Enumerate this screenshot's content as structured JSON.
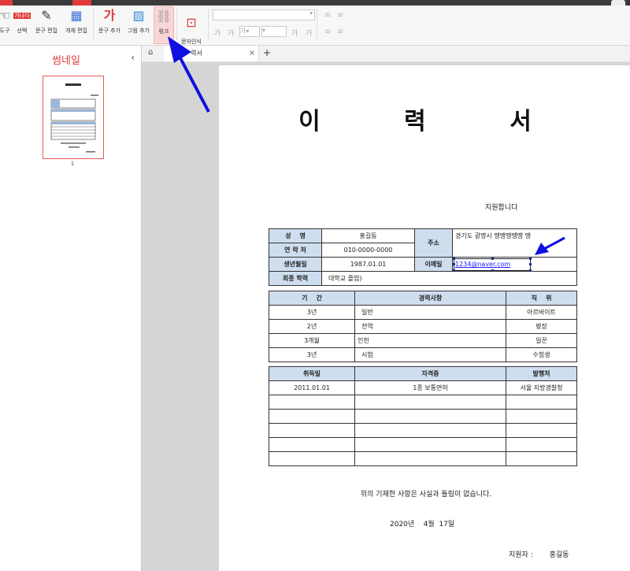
{
  "toolbar": {
    "tools": [
      {
        "name": "hand-tool",
        "label": "도구"
      },
      {
        "name": "select-tool",
        "label": "선택"
      },
      {
        "name": "edit-text-tool",
        "label": "문구 편집"
      },
      {
        "name": "edit-object-tool",
        "label": "개체 편집"
      },
      {
        "name": "add-text-tool",
        "label": "문구 추가"
      },
      {
        "name": "add-image-tool",
        "label": "그림 추가"
      },
      {
        "name": "link-tool",
        "label": "링크"
      },
      {
        "name": "ocr-tool",
        "label": "문자인식\n(OCR)"
      }
    ],
    "select_icon_text": "가나다",
    "add_text_icon": "가",
    "format_buttons": [
      "가",
      "가",
      "가",
      "가",
      "가",
      "가"
    ]
  },
  "thumbnail_panel": {
    "title": "썸네일",
    "page_number": "1"
  },
  "doc_tab": {
    "name": "력서"
  },
  "document": {
    "title": "이 력 서",
    "apply_text": "지원합니다",
    "personal": {
      "name_label": "성    명",
      "name_value": "홍길동",
      "address_label": "주소",
      "address_value": "경기도 광명시 땡땡땡땡땡 땡",
      "phone_label": "연 락 처",
      "phone_value": "010-0000-0000",
      "birth_label": "생년월일",
      "birth_value": "1987.01.01",
      "email_label": "이메일",
      "email_value": "1234@naver.com",
      "edu_label": "최종 학력",
      "edu_value": "대학교 졸업)"
    },
    "career": {
      "headers": [
        "기    간",
        "경력사항",
        "직    위"
      ],
      "rows": [
        [
          "3년",
          "일반",
          "아르바이트"
        ],
        [
          "2년",
          "전역",
          "병장"
        ],
        [
          "3개월",
          "인천",
          "일꾼"
        ],
        [
          "3년",
          "시험",
          "수험생"
        ]
      ]
    },
    "license": {
      "headers": [
        "취득일",
        "자격증",
        "발행처"
      ],
      "rows": [
        [
          "2011.01.01",
          "1종 보통면허",
          "서울 지방경찰청"
        ],
        [
          "",
          "",
          ""
        ],
        [
          "",
          "",
          ""
        ],
        [
          "",
          "",
          ""
        ],
        [
          "",
          "",
          ""
        ],
        [
          "",
          "",
          ""
        ]
      ]
    },
    "statement": "위의 기재한 사항은 사실과 틀림이 없습니다.",
    "date": "2020년    4월  17일",
    "signer_label": "지원자 :",
    "signer_name": "홍길동"
  },
  "colors": {
    "accent": "#e03a3a",
    "header_fill": "#cfdeef",
    "arrow": "#1010e0"
  }
}
